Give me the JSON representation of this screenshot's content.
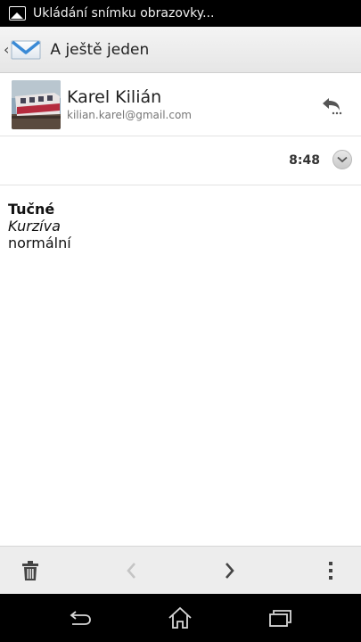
{
  "status_bar": {
    "notification_icon": "picture-icon",
    "text": "Ukládání snímku obrazovky..."
  },
  "action_bar": {
    "app_icon": "email-envelope-icon",
    "title": "A ještě jeden"
  },
  "sender": {
    "name": "Karel Kilián",
    "email": "kilian.karel@gmail.com",
    "reply_icon": "reply-icon"
  },
  "meta": {
    "time": "8:48",
    "expand_icon": "chevron-down-icon"
  },
  "body": {
    "lines": [
      "Tučné",
      "Kurzíva",
      "normální"
    ]
  },
  "toolbar": {
    "icons": [
      "trash-icon",
      "chevron-left-icon",
      "chevron-right-icon",
      "overflow-menu-icon"
    ]
  },
  "navigation": {
    "icons": [
      "back-icon",
      "home-icon",
      "recent-apps-icon"
    ]
  },
  "colors": {
    "accent_blue": "#3a8ad6",
    "status_bar": "#000000",
    "toolbar": "#ededed"
  }
}
